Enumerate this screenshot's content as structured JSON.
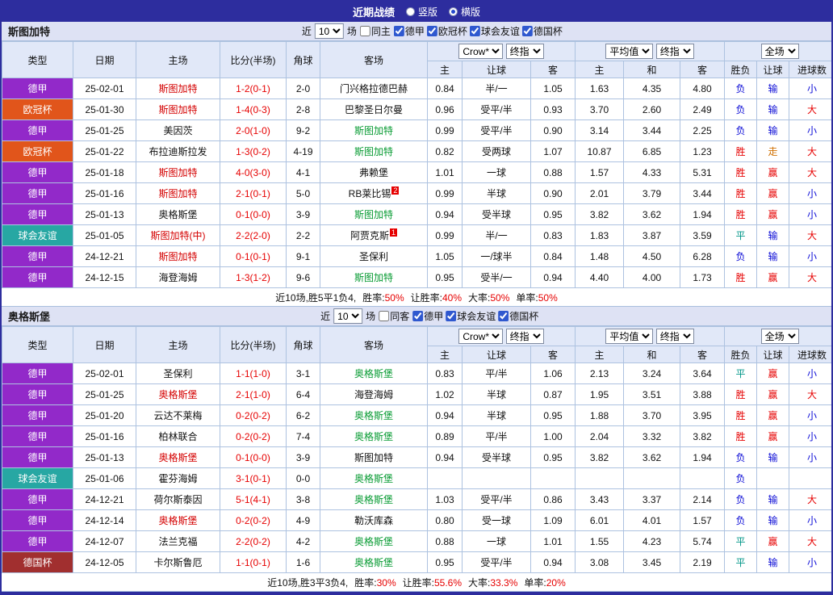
{
  "topbar": {
    "title": "近期战绩",
    "vertical_label": "竖版",
    "horizontal_label": "横版",
    "selected_layout": "横版"
  },
  "type_colors": {
    "德甲": "#9229c9",
    "欧冠杯": "#e1551b",
    "球会友谊": "#27a7a3",
    "德国杯": "#a12f2f"
  },
  "result_colors": {
    "胜": "#e60000",
    "赢": "#e60000",
    "大": "#e60000",
    "负": "#0b0bd6",
    "输": "#0b0bd6",
    "小": "#0b0bd6",
    "平": "#009688",
    "走": "#d07000"
  },
  "sections": [
    {
      "team": "斯图加特",
      "filter": {
        "recent_label": "近",
        "recent_value": "10",
        "games_label": "场",
        "same_venue_label": "同主",
        "leagues": [
          "德甲",
          "欧冠杯",
          "球会友谊",
          "德国杯"
        ]
      },
      "selectors": {
        "odds_source": "Crow*",
        "odds_stage": "终指",
        "avg": "平均值",
        "avg_stage": "终指",
        "scope": "全场"
      },
      "headers": {
        "type": "类型",
        "date": "日期",
        "home": "主场",
        "score": "比分(半场)",
        "corner": "角球",
        "away": "客场",
        "sub": [
          "主",
          "让球",
          "客",
          "主",
          "和",
          "客",
          "胜负",
          "让球",
          "进球数"
        ]
      },
      "rows": [
        {
          "type": "德甲",
          "date": "25-02-01",
          "home": "斯图加特",
          "home_focus": true,
          "score": "1-2(0-1)",
          "corner": "2-0",
          "away": "门兴格拉德巴赫",
          "odds": [
            "0.84",
            "半/一",
            "1.05",
            "1.63",
            "4.35",
            "4.80"
          ],
          "results": [
            "负",
            "输",
            "小"
          ]
        },
        {
          "type": "欧冠杯",
          "date": "25-01-30",
          "home": "斯图加特",
          "home_focus": true,
          "score": "1-4(0-3)",
          "corner": "2-8",
          "away": "巴黎圣日尔曼",
          "odds": [
            "0.96",
            "受平/半",
            "0.93",
            "3.70",
            "2.60",
            "2.49"
          ],
          "results": [
            "负",
            "输",
            "大"
          ]
        },
        {
          "type": "德甲",
          "date": "25-01-25",
          "home": "美因茨",
          "score": "2-0(1-0)",
          "corner": "9-2",
          "away": "斯图加特",
          "away_focus": true,
          "odds": [
            "0.99",
            "受平/半",
            "0.90",
            "3.14",
            "3.44",
            "2.25"
          ],
          "results": [
            "负",
            "输",
            "小"
          ]
        },
        {
          "type": "欧冠杯",
          "date": "25-01-22",
          "home": "布拉迪斯拉发",
          "score": "1-3(0-2)",
          "corner": "4-19",
          "away": "斯图加特",
          "away_focus": true,
          "odds": [
            "0.82",
            "受两球",
            "1.07",
            "10.87",
            "6.85",
            "1.23"
          ],
          "results": [
            "胜",
            "走",
            "大"
          ]
        },
        {
          "type": "德甲",
          "date": "25-01-18",
          "home": "斯图加特",
          "home_focus": true,
          "score": "4-0(3-0)",
          "corner": "4-1",
          "away": "弗赖堡",
          "odds": [
            "1.01",
            "一球",
            "0.88",
            "1.57",
            "4.33",
            "5.31"
          ],
          "results": [
            "胜",
            "赢",
            "大"
          ]
        },
        {
          "type": "德甲",
          "date": "25-01-16",
          "home": "斯图加特",
          "home_focus": true,
          "score": "2-1(0-1)",
          "corner": "5-0",
          "away": "RB莱比锡",
          "away_badge": "2",
          "odds": [
            "0.99",
            "半球",
            "0.90",
            "2.01",
            "3.79",
            "3.44"
          ],
          "results": [
            "胜",
            "赢",
            "小"
          ]
        },
        {
          "type": "德甲",
          "date": "25-01-13",
          "home": "奥格斯堡",
          "score": "0-1(0-0)",
          "corner": "3-9",
          "away": "斯图加特",
          "away_focus": true,
          "odds": [
            "0.94",
            "受半球",
            "0.95",
            "3.82",
            "3.62",
            "1.94"
          ],
          "results": [
            "胜",
            "赢",
            "小"
          ]
        },
        {
          "type": "球会友谊",
          "date": "25-01-05",
          "home": "斯图加特(中)",
          "home_focus": true,
          "score": "2-2(2-0)",
          "corner": "2-2",
          "away": "阿贾克斯",
          "away_badge": "1",
          "odds": [
            "0.99",
            "半/一",
            "0.83",
            "1.83",
            "3.87",
            "3.59"
          ],
          "results": [
            "平",
            "输",
            "大"
          ]
        },
        {
          "type": "德甲",
          "date": "24-12-21",
          "home": "斯图加特",
          "home_focus": true,
          "score": "0-1(0-1)",
          "corner": "9-1",
          "away": "圣保利",
          "odds": [
            "1.05",
            "一/球半",
            "0.84",
            "1.48",
            "4.50",
            "6.28"
          ],
          "results": [
            "负",
            "输",
            "小"
          ]
        },
        {
          "type": "德甲",
          "date": "24-12-15",
          "home": "海登海姆",
          "score": "1-3(1-2)",
          "corner": "9-6",
          "away": "斯图加特",
          "away_focus": true,
          "odds": [
            "0.95",
            "受半/一",
            "0.94",
            "4.40",
            "4.00",
            "1.73"
          ],
          "results": [
            "胜",
            "赢",
            "大"
          ]
        }
      ],
      "summary": {
        "prefix": "近10场,胜5平1负4,",
        "stats": [
          {
            "label": "胜率:",
            "value": "50%"
          },
          {
            "label": "让胜率:",
            "value": "40%"
          },
          {
            "label": "大率:",
            "value": "50%"
          },
          {
            "label": "单率:",
            "value": "50%"
          }
        ]
      }
    },
    {
      "team": "奥格斯堡",
      "filter": {
        "recent_label": "近",
        "recent_value": "10",
        "games_label": "场",
        "same_venue_label": "同客",
        "leagues": [
          "德甲",
          "球会友谊",
          "德国杯"
        ]
      },
      "selectors": {
        "odds_source": "Crow*",
        "odds_stage": "终指",
        "avg": "平均值",
        "avg_stage": "终指",
        "scope": "全场"
      },
      "headers": {
        "type": "类型",
        "date": "日期",
        "home": "主场",
        "score": "比分(半场)",
        "corner": "角球",
        "away": "客场",
        "sub": [
          "主",
          "让球",
          "客",
          "主",
          "和",
          "客",
          "胜负",
          "让球",
          "进球数"
        ]
      },
      "rows": [
        {
          "type": "德甲",
          "date": "25-02-01",
          "home": "圣保利",
          "score": "1-1(1-0)",
          "corner": "3-1",
          "away": "奥格斯堡",
          "away_focus": true,
          "odds": [
            "0.83",
            "平/半",
            "1.06",
            "2.13",
            "3.24",
            "3.64"
          ],
          "results": [
            "平",
            "赢",
            "小"
          ]
        },
        {
          "type": "德甲",
          "date": "25-01-25",
          "home": "奥格斯堡",
          "home_focus": true,
          "score": "2-1(1-0)",
          "corner": "6-4",
          "away": "海登海姆",
          "odds": [
            "1.02",
            "半球",
            "0.87",
            "1.95",
            "3.51",
            "3.88"
          ],
          "results": [
            "胜",
            "赢",
            "大"
          ]
        },
        {
          "type": "德甲",
          "date": "25-01-20",
          "home": "云达不莱梅",
          "score": "0-2(0-2)",
          "corner": "6-2",
          "away": "奥格斯堡",
          "away_focus": true,
          "odds": [
            "0.94",
            "半球",
            "0.95",
            "1.88",
            "3.70",
            "3.95"
          ],
          "results": [
            "胜",
            "赢",
            "小"
          ]
        },
        {
          "type": "德甲",
          "date": "25-01-16",
          "home": "柏林联合",
          "score": "0-2(0-2)",
          "corner": "7-4",
          "away": "奥格斯堡",
          "away_focus": true,
          "odds": [
            "0.89",
            "平/半",
            "1.00",
            "2.04",
            "3.32",
            "3.82"
          ],
          "results": [
            "胜",
            "赢",
            "小"
          ]
        },
        {
          "type": "德甲",
          "date": "25-01-13",
          "home": "奥格斯堡",
          "home_focus": true,
          "score": "0-1(0-0)",
          "corner": "3-9",
          "away": "斯图加特",
          "odds": [
            "0.94",
            "受半球",
            "0.95",
            "3.82",
            "3.62",
            "1.94"
          ],
          "results": [
            "负",
            "输",
            "小"
          ]
        },
        {
          "type": "球会友谊",
          "date": "25-01-06",
          "home": "霍芬海姆",
          "score": "3-1(0-1)",
          "corner": "0-0",
          "away": "奥格斯堡",
          "away_focus": true,
          "odds": [
            "",
            "",
            "",
            "",
            "",
            ""
          ],
          "results": [
            "负",
            "",
            ""
          ]
        },
        {
          "type": "德甲",
          "date": "24-12-21",
          "home": "荷尔斯泰因",
          "score": "5-1(4-1)",
          "corner": "3-8",
          "away": "奥格斯堡",
          "away_focus": true,
          "odds": [
            "1.03",
            "受平/半",
            "0.86",
            "3.43",
            "3.37",
            "2.14"
          ],
          "results": [
            "负",
            "输",
            "大"
          ]
        },
        {
          "type": "德甲",
          "date": "24-12-14",
          "home": "奥格斯堡",
          "home_focus": true,
          "score": "0-2(0-2)",
          "corner": "4-9",
          "away": "勒沃库森",
          "odds": [
            "0.80",
            "受一球",
            "1.09",
            "6.01",
            "4.01",
            "1.57"
          ],
          "results": [
            "负",
            "输",
            "小"
          ]
        },
        {
          "type": "德甲",
          "date": "24-12-07",
          "home": "法兰克福",
          "score": "2-2(0-2)",
          "corner": "4-2",
          "away": "奥格斯堡",
          "away_focus": true,
          "odds": [
            "0.88",
            "一球",
            "1.01",
            "1.55",
            "4.23",
            "5.74"
          ],
          "results": [
            "平",
            "赢",
            "大"
          ]
        },
        {
          "type": "德国杯",
          "date": "24-12-05",
          "home": "卡尔斯鲁厄",
          "score": "1-1(0-1)",
          "corner": "1-6",
          "away": "奥格斯堡",
          "away_focus": true,
          "odds": [
            "0.95",
            "受平/半",
            "0.94",
            "3.08",
            "3.45",
            "2.19"
          ],
          "results": [
            "平",
            "输",
            "小"
          ]
        }
      ],
      "summary": {
        "prefix": "近10场,胜3平3负4,",
        "stats": [
          {
            "label": "胜率:",
            "value": "30%"
          },
          {
            "label": "让胜率:",
            "value": "55.6%"
          },
          {
            "label": "大率:",
            "value": "33.3%"
          },
          {
            "label": "单率:",
            "value": "20%"
          }
        ]
      }
    }
  ]
}
